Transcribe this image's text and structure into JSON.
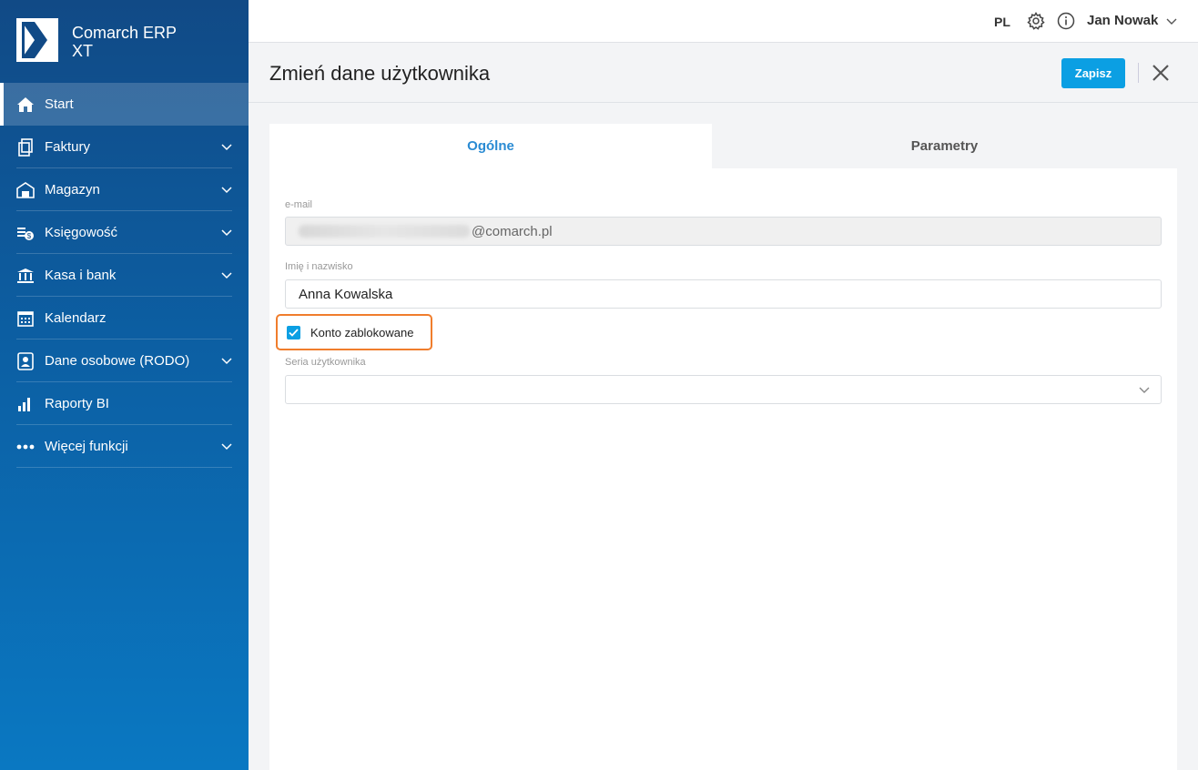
{
  "brand": {
    "line1": "Comarch ERP",
    "line2": "XT"
  },
  "sidebar": {
    "items": [
      {
        "label": "Start",
        "icon": "home-icon",
        "active": true,
        "expandable": false
      },
      {
        "label": "Faktury",
        "icon": "documents-icon",
        "expandable": true
      },
      {
        "label": "Magazyn",
        "icon": "warehouse-icon",
        "expandable": true
      },
      {
        "label": "Księgowość",
        "icon": "accounting-icon",
        "expandable": true
      },
      {
        "label": "Kasa i bank",
        "icon": "bank-icon",
        "expandable": true
      },
      {
        "label": "Kalendarz",
        "icon": "calendar-icon",
        "expandable": false
      },
      {
        "label": "Dane osobowe (RODO)",
        "icon": "person-card-icon",
        "expandable": true
      },
      {
        "label": "Raporty BI",
        "icon": "bar-chart-icon",
        "expandable": false
      },
      {
        "label": "Więcej funkcji",
        "icon": "more-dots-icon",
        "expandable": true
      }
    ]
  },
  "topbar": {
    "lang": "PL",
    "user": "Jan Nowak"
  },
  "header": {
    "title": "Zmień dane użytkownika",
    "save_label": "Zapisz"
  },
  "tabs": {
    "general": "Ogólne",
    "params": "Parametry"
  },
  "form": {
    "email_label": "e-mail",
    "email_domain": "@comarch.pl",
    "name_label": "Imię i nazwisko",
    "name_value": "Anna Kowalska",
    "blocked_label": "Konto zablokowane",
    "blocked_checked": true,
    "series_label": "Seria użytkownika",
    "series_value": ""
  },
  "colors": {
    "accent": "#0b9fe3",
    "highlight": "#f07d2c",
    "sidebar": "#114a86"
  }
}
